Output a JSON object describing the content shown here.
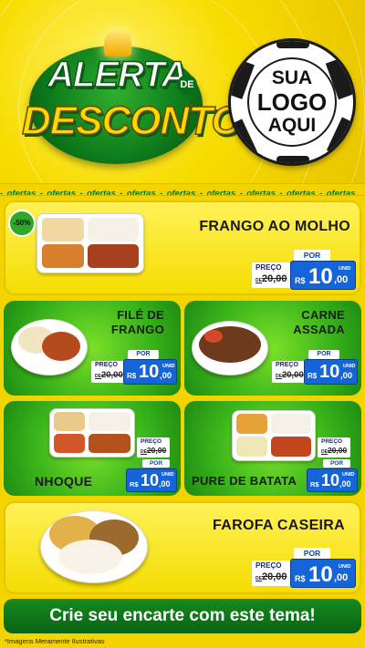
{
  "header": {
    "alert_word": "ALERTA",
    "de_word": "DE",
    "discount_word": "DESCONTO",
    "logo_lines": [
      "SUA",
      "LOGO",
      "AQUI"
    ]
  },
  "ticker": {
    "items": [
      "ofertas",
      "ofertas",
      "ofertas",
      "ofertas",
      "ofertas",
      "ofertas",
      "ofertas",
      "ofertas",
      "ofertas"
    ],
    "separator": " - "
  },
  "discount_badge": "-50%",
  "price_common": {
    "preco_label": "PREÇO",
    "por_label": "POR",
    "old_prefix": "DE",
    "old_value": "20,00",
    "currency": "R$",
    "unit": "UNID",
    "new_int": "10",
    "new_dec": ",00"
  },
  "products": [
    {
      "name": "FRANGO AO MOLHO"
    },
    {
      "name_line1": "FILÉ DE",
      "name_line2": "FRANGO"
    },
    {
      "name_line1": "CARNE",
      "name_line2": "ASSADA"
    },
    {
      "name": "NHOQUE"
    },
    {
      "name": "PURE DE BATATA"
    },
    {
      "name": "FAROFA CASEIRA"
    }
  ],
  "footer": {
    "cta": "Crie seu encarte com este tema!",
    "disclaimer": "*Imagens Meramente Ilustrativas"
  },
  "colors": {
    "brand_green": "#0c7a1a",
    "brand_yellow": "#f3d400",
    "price_blue": "#1565d8"
  }
}
